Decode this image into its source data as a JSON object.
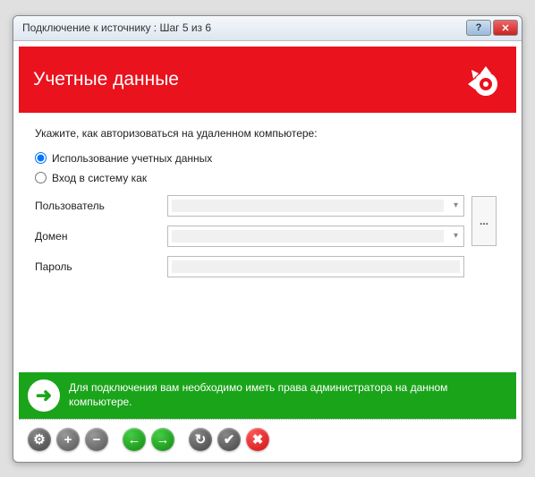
{
  "window": {
    "title": "Подключение к источнику : Шаг 5 из 6"
  },
  "banner": {
    "heading": "Учетные данные"
  },
  "form": {
    "instruction": "Укажите, как авторизоваться на удаленном компьютере:",
    "radio_use_credentials": "Использование учетных данных",
    "radio_login_as": "Вход в систему как",
    "label_user": "Пользователь",
    "label_domain": "Домен",
    "label_password": "Пароль",
    "browse_label": "..."
  },
  "info": {
    "text": "Для подключения вам необходимо иметь права администратора на данном компьютере."
  },
  "toolbar": {
    "gear": "⚙",
    "plus": "+",
    "minus": "−",
    "back": "←",
    "forward": "→",
    "refresh": "↻",
    "apply": "✔",
    "cancel": "✖"
  }
}
